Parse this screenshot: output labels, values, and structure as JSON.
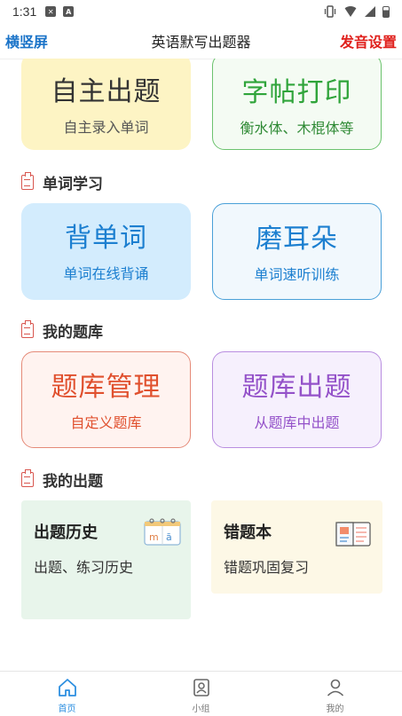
{
  "status": {
    "time": "1:31"
  },
  "header": {
    "left": "横竖屏",
    "title": "英语默写出题器",
    "right": "发音设置"
  },
  "cards_top": {
    "self": {
      "title": "自主出题",
      "subtitle": "自主录入单词"
    },
    "copybook": {
      "title": "字帖打印",
      "subtitle": "衡水体、木棍体等"
    }
  },
  "sections": {
    "words": "单词学习",
    "bank": "我的题库",
    "mine": "我的出题"
  },
  "cards_words": {
    "recite": {
      "title": "背单词",
      "subtitle": "单词在线背诵"
    },
    "listen": {
      "title": "磨耳朵",
      "subtitle": "单词速听训练"
    }
  },
  "cards_bank": {
    "manage": {
      "title": "题库管理",
      "subtitle": "自定义题库"
    },
    "quiz": {
      "title": "题库出题",
      "subtitle": "从题库中出题"
    }
  },
  "panels": {
    "history": {
      "title": "出题历史",
      "desc": "出题、练习历史"
    },
    "wrong": {
      "title": "错题本",
      "desc": "错题巩固复习"
    }
  },
  "tabs": [
    {
      "label": "首页",
      "active": true
    },
    {
      "label": "小组",
      "active": false
    },
    {
      "label": "我的",
      "active": false
    }
  ],
  "colors": {
    "accent_blue": "#1a73c8",
    "alert_red": "#e0201c",
    "tab_active": "#2d8fe0"
  }
}
